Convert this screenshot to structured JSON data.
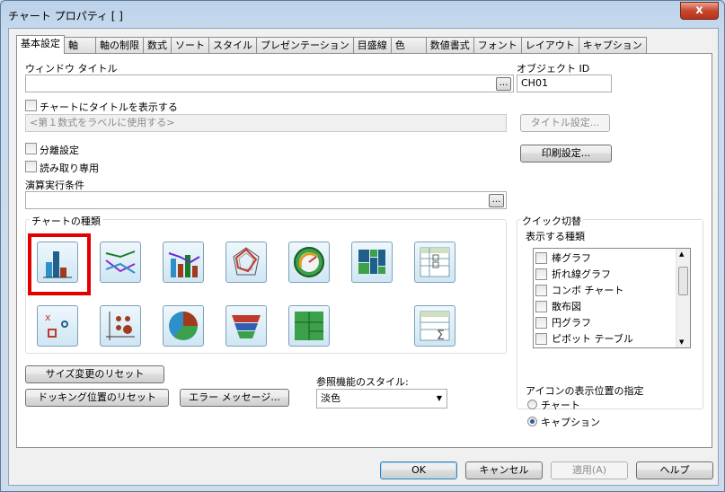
{
  "window": {
    "title": "チャート プロパティ [ ]",
    "close_symbol": "x"
  },
  "tabs": [
    "基本設定",
    "軸",
    "軸の制限",
    "数式",
    "ソート",
    "スタイル",
    "プレゼンテーション",
    "目盛線",
    "色",
    "数値書式",
    "フォント",
    "レイアウト",
    "キャプション"
  ],
  "window_title_section": {
    "label": "ウィンドウ タイトル",
    "value": "",
    "browse": "..."
  },
  "object_id": {
    "label": "オブジェクト ID",
    "value": "CH01"
  },
  "show_title": {
    "label": "チャートにタイトルを表示する",
    "checked": false,
    "placeholder": "<第１数式をラベルに使用する>"
  },
  "title_settings_button": "タイトル設定...",
  "detach": {
    "label": "分離設定",
    "checked": false
  },
  "print_settings_button": "印刷設定...",
  "readonly": {
    "label": "読み取り専用",
    "checked": false
  },
  "calc_condition": {
    "label": "演算実行条件",
    "value": "",
    "browse": "..."
  },
  "chart_types": {
    "label": "チャートの種類",
    "selected": "bar-chart",
    "icons": [
      "bar-chart-icon",
      "line-chart-icon",
      "combo-chart-icon",
      "radar-chart-icon",
      "gauge-chart-icon",
      "mekko-chart-icon",
      "pivot-table-icon",
      "scatter-chart-icon",
      "grid-chart-icon",
      "pie-chart-icon",
      "funnel-chart-icon",
      "block-chart-icon",
      "straight-table-icon"
    ]
  },
  "quick_switch": {
    "label": "クイック切替",
    "types_label": "表示する種類",
    "types": [
      {
        "label": "棒グラフ",
        "checked": false
      },
      {
        "label": "折れ線グラフ",
        "checked": false
      },
      {
        "label": "コンボ チャート",
        "checked": false
      },
      {
        "label": "散布図",
        "checked": false
      },
      {
        "label": "円グラフ",
        "checked": false
      },
      {
        "label": "ピボット テーブル",
        "checked": false
      }
    ],
    "icon_position_label": "アイコンの表示位置の指定",
    "icon_position_options": [
      {
        "label": "チャート",
        "selected": false
      },
      {
        "label": "キャプション",
        "selected": true
      }
    ]
  },
  "reset_size_button": "サイズ変更のリセット",
  "reset_dock_button": "ドッキング位置のリセット",
  "error_message_button": "エラー メッセージ...",
  "reference_style": {
    "label": "参照機能のスタイル:",
    "value": "淡色"
  },
  "footer": {
    "ok": "OK",
    "cancel": "キャンセル",
    "apply": "適用(A)",
    "help": "ヘルプ"
  }
}
